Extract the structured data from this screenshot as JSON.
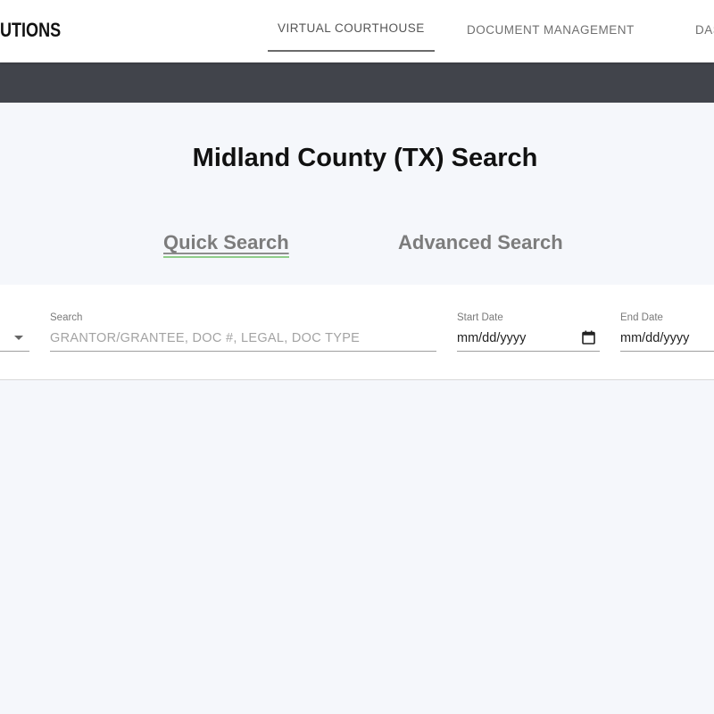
{
  "header": {
    "brand": "UTIONS",
    "tabs": [
      {
        "label": "VIRTUAL COURTHOUSE",
        "active": true
      },
      {
        "label": "DOCUMENT MANAGEMENT",
        "active": false
      },
      {
        "label": "DAS",
        "active": false
      }
    ]
  },
  "main": {
    "title": "Midland County (TX) Search",
    "search_tabs": [
      {
        "label": "Quick Search",
        "active": true
      },
      {
        "label": "Advanced Search",
        "active": false
      }
    ]
  },
  "search_form": {
    "search": {
      "label": "Search",
      "value": "",
      "placeholder": "GRANTOR/GRANTEE, DOC #, LEGAL, DOC TYPE"
    },
    "start_date": {
      "label": "Start Date",
      "value": "mm/dd/yyyy"
    },
    "end_date": {
      "label": "End Date",
      "value": "mm/dd/yyyy"
    }
  },
  "colors": {
    "nav_background": "#ffffff",
    "dark_band": "#41444b",
    "page_background": "#f5f7fb",
    "tab_underline_accent": "#7cc576"
  },
  "icons": [
    "chevron-down-icon",
    "calendar-icon"
  ]
}
